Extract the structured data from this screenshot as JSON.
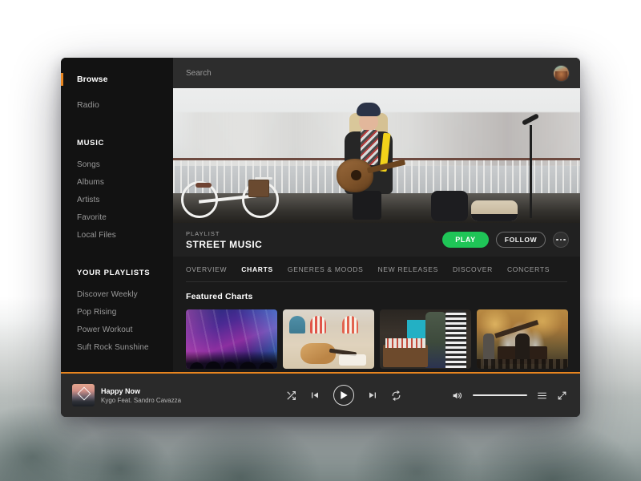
{
  "window": {
    "accent_orange": "#e8851f",
    "accent_green": "#1fc557",
    "sidebar_bg": "#121212",
    "main_bg": "#1a1a1a",
    "player_bg": "#2a2a2a"
  },
  "sidebar": {
    "top_items": [
      {
        "label": "Browse",
        "active": true
      },
      {
        "label": "Radio",
        "active": false
      }
    ],
    "music_section": {
      "heading": "MUSIC",
      "items": [
        {
          "label": "Songs"
        },
        {
          "label": "Albums"
        },
        {
          "label": "Artists"
        },
        {
          "label": "Favorite"
        },
        {
          "label": "Local Files"
        }
      ]
    },
    "playlists_section": {
      "heading": "YOUR PLAYLISTS",
      "items": [
        {
          "label": "Discover Weekly"
        },
        {
          "label": "Pop Rising"
        },
        {
          "label": "Power Workout"
        },
        {
          "label": "Suft Rock Sunshine"
        }
      ]
    }
  },
  "topbar": {
    "search_placeholder": "Search",
    "search_value": "",
    "avatar_name": "user-avatar"
  },
  "hero": {
    "image_description": "street musician playing acoustic guitar on a bridge with bicycle"
  },
  "playlist_header": {
    "kicker": "PLAYLIST",
    "name": "STREET MUSIC",
    "play_label": "PLAY",
    "follow_label": "FOLLOW",
    "more_label": "•••"
  },
  "tabs": [
    {
      "label": "OVERVIEW",
      "active": false
    },
    {
      "label": "CHARTS",
      "active": true
    },
    {
      "label": "GENERES & MOODS",
      "active": false
    },
    {
      "label": "NEW RELEASES",
      "active": false
    },
    {
      "label": "DISCOVER",
      "active": false
    },
    {
      "label": "CONCERTS",
      "active": false
    }
  ],
  "featured": {
    "title": "Featured Charts",
    "cards": [
      {
        "name": "card-concert-stage"
      },
      {
        "name": "card-beach-guitar"
      },
      {
        "name": "card-record-market"
      },
      {
        "name": "card-outdoor-piano"
      }
    ]
  },
  "player": {
    "track_title": "Happy Now",
    "track_artist": "Kygo Feat. Sandro Cavazza",
    "controls": {
      "shuffle": "shuffle",
      "previous": "previous-track",
      "play": "play",
      "next": "next-track",
      "repeat": "repeat"
    },
    "volume": {
      "icon": "volume-icon",
      "level": 100
    },
    "queue_label": "queue",
    "expand_label": "expand"
  }
}
